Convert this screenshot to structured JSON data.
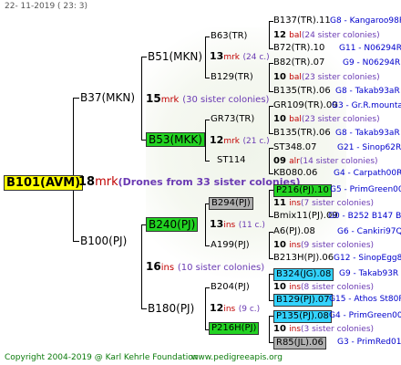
{
  "date": "22- 11-2019 ( 23: 3)",
  "footer": {
    "copyright": "Copyright 2004-2019 @ Karl Kehrle Foundation",
    "site": "www.pedigreeapis.org"
  },
  "root": {
    "name": "B101(AVM)",
    "num": "18",
    "suffix": "mrk",
    "note": "(Drones from 33 sister colonies)"
  },
  "g1": [
    {
      "name": "B37(MKN)",
      "num": "15",
      "suffix": "mrk",
      "note": "(30 sister colonies)"
    },
    {
      "name": "B100(PJ)",
      "num": "16",
      "suffix": "ins",
      "note": "(10 sister colonies)"
    }
  ],
  "g2": [
    {
      "name": "B51(MKN)",
      "num": "13",
      "suffix": "mrk",
      "note": "(24 c.)"
    },
    {
      "name": "B53(MKK)",
      "num": "12",
      "suffix": "mrk",
      "note": "(21 c.)"
    },
    {
      "name": "B240(PJ)",
      "num": "13",
      "suffix": "ins",
      "note": "(11 c.)"
    },
    {
      "name": "B180(PJ)",
      "num": "12",
      "suffix": "ins",
      "note": "(9 c.)"
    }
  ],
  "g3": [
    {
      "name": "B63(TR)",
      "num": "12",
      "suffix": "bal",
      "note": "(24 sister colonies)"
    },
    {
      "name": "B129(TR)",
      "num": "10",
      "suffix": "bal",
      "note": "(23 sister colonies)"
    },
    {
      "name": "GR73(TR)",
      "num": "10",
      "suffix": "bal",
      "note": "(23 sister colonies)"
    },
    {
      "name": "ST114",
      "num": "09",
      "suffix": "alr",
      "note": "(14 sister colonies)"
    },
    {
      "name": "B294(PJ)",
      "num": "11",
      "suffix": "ins",
      "note": "(7 sister colonies)"
    },
    {
      "name": "A199(PJ)",
      "num": "10",
      "suffix": "ins",
      "note": "(9 sister colonies)"
    },
    {
      "name": "B204(PJ)",
      "num": "10",
      "suffix": "ins",
      "note": "(8 sister colonies)"
    },
    {
      "name": "P216H(PJ)",
      "num": "10",
      "suffix": "ins",
      "note": "(3 sister colonies)"
    }
  ],
  "g4": [
    {
      "name": "B137(TR).11",
      "info": "G8 - Kangaroo98R"
    },
    {
      "name": "B72(TR).10",
      "info": "G11 - N06294R"
    },
    {
      "name": "B82(TR).07",
      "info": "G9 - N06294R"
    },
    {
      "name": "B135(TR).06",
      "info": "G8 - Takab93aR"
    },
    {
      "name": "GR109(TR).09",
      "info": "G3 - Gr.R.mounta"
    },
    {
      "name": "B135(TR).06",
      "info": "G8 - Takab93aR"
    },
    {
      "name": "ST348.07",
      "info": "G21 - Sinop62R"
    },
    {
      "name": "KB080.06",
      "info": "G4 - Carpath00R"
    },
    {
      "name": "P216(PJ).10",
      "info": "G5 - PrimGreen00"
    },
    {
      "name": "Bmix11(PJ).09",
      "info": "G0 - B252 B147 B"
    },
    {
      "name": "A6(PJ).08",
      "info": "G6 - Cankiri97Q"
    },
    {
      "name": "B213H(PJ).06",
      "info": "G12 - SinopEgg86R"
    },
    {
      "name": "B324(JG).08",
      "info": "G9 - Takab93R"
    },
    {
      "name": "B129(PJ).07",
      "info": "G15 - Athos St80R"
    },
    {
      "name": "P135(PJ).08",
      "info": "G4 - PrimGreen00"
    },
    {
      "name": "R85(JL).06",
      "info": "G3 - PrimRed01"
    }
  ]
}
